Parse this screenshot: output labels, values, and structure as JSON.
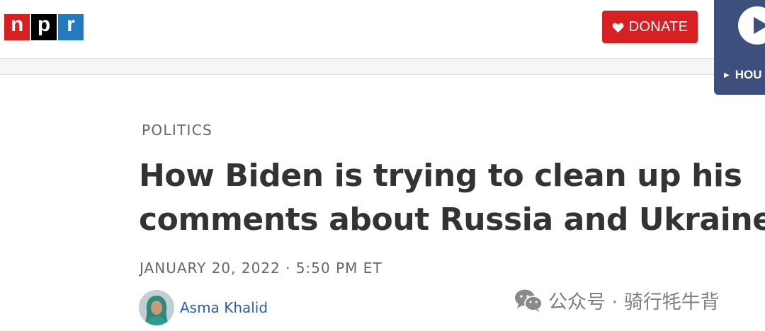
{
  "header": {
    "logo": {
      "letters": [
        "n",
        "p",
        "r"
      ],
      "colors": [
        "#d62021",
        "#000000",
        "#237bbd"
      ]
    },
    "donate_label": "DONATE",
    "donate_icon": "heart-icon",
    "accent_color": "#d62021"
  },
  "player": {
    "play_icon": "play-icon",
    "hourly_label": "HOU",
    "background_color": "#3d4f7c"
  },
  "article": {
    "section": "POLITICS",
    "title_line1": "How Biden is trying to clean up his",
    "title_line2": "comments about Russia and Ukraine",
    "dateline": "JANUARY 20, 2022 · 5:50 PM ET",
    "author": "Asma Khalid",
    "author_color": "#2a5ea8"
  },
  "watermark": {
    "icon": "wechat-icon",
    "text": "公众号 · 骑行牦牛背"
  }
}
